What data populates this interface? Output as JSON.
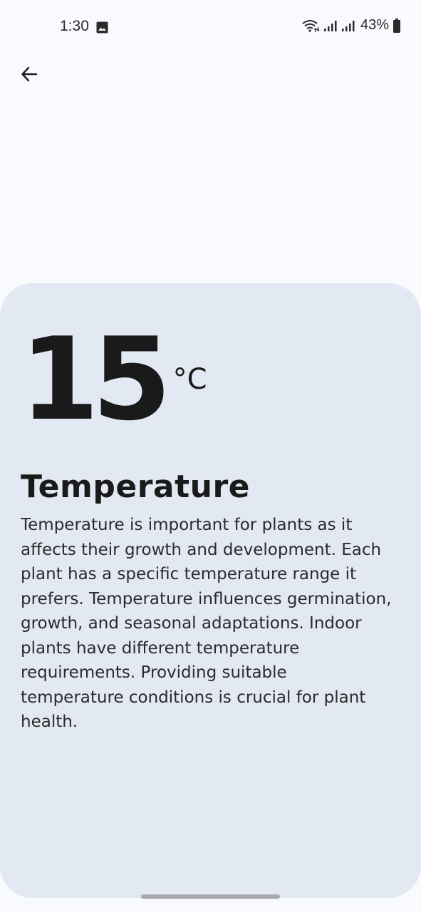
{
  "status_bar": {
    "time": "1:30",
    "battery": "43%",
    "icons": [
      "gallery-icon",
      "wifi-icon",
      "signal-icon",
      "signal-icon",
      "battery-icon"
    ]
  },
  "header": {
    "back_icon": "arrow-left-icon"
  },
  "card": {
    "value": "15",
    "unit": "°C",
    "title": "Temperature",
    "description": "Temperature is important for plants as it affects their growth and development. Each plant has a specific temperature range it prefers. Temperature influences germination, growth, and seasonal adaptations. Indoor plants have different temperature requirements. Providing suitable temperature conditions is crucial for plant health."
  },
  "colors": {
    "page_background": "#f8fafd",
    "card_background": "#e2e9f2",
    "text": "#1a1a1a"
  }
}
